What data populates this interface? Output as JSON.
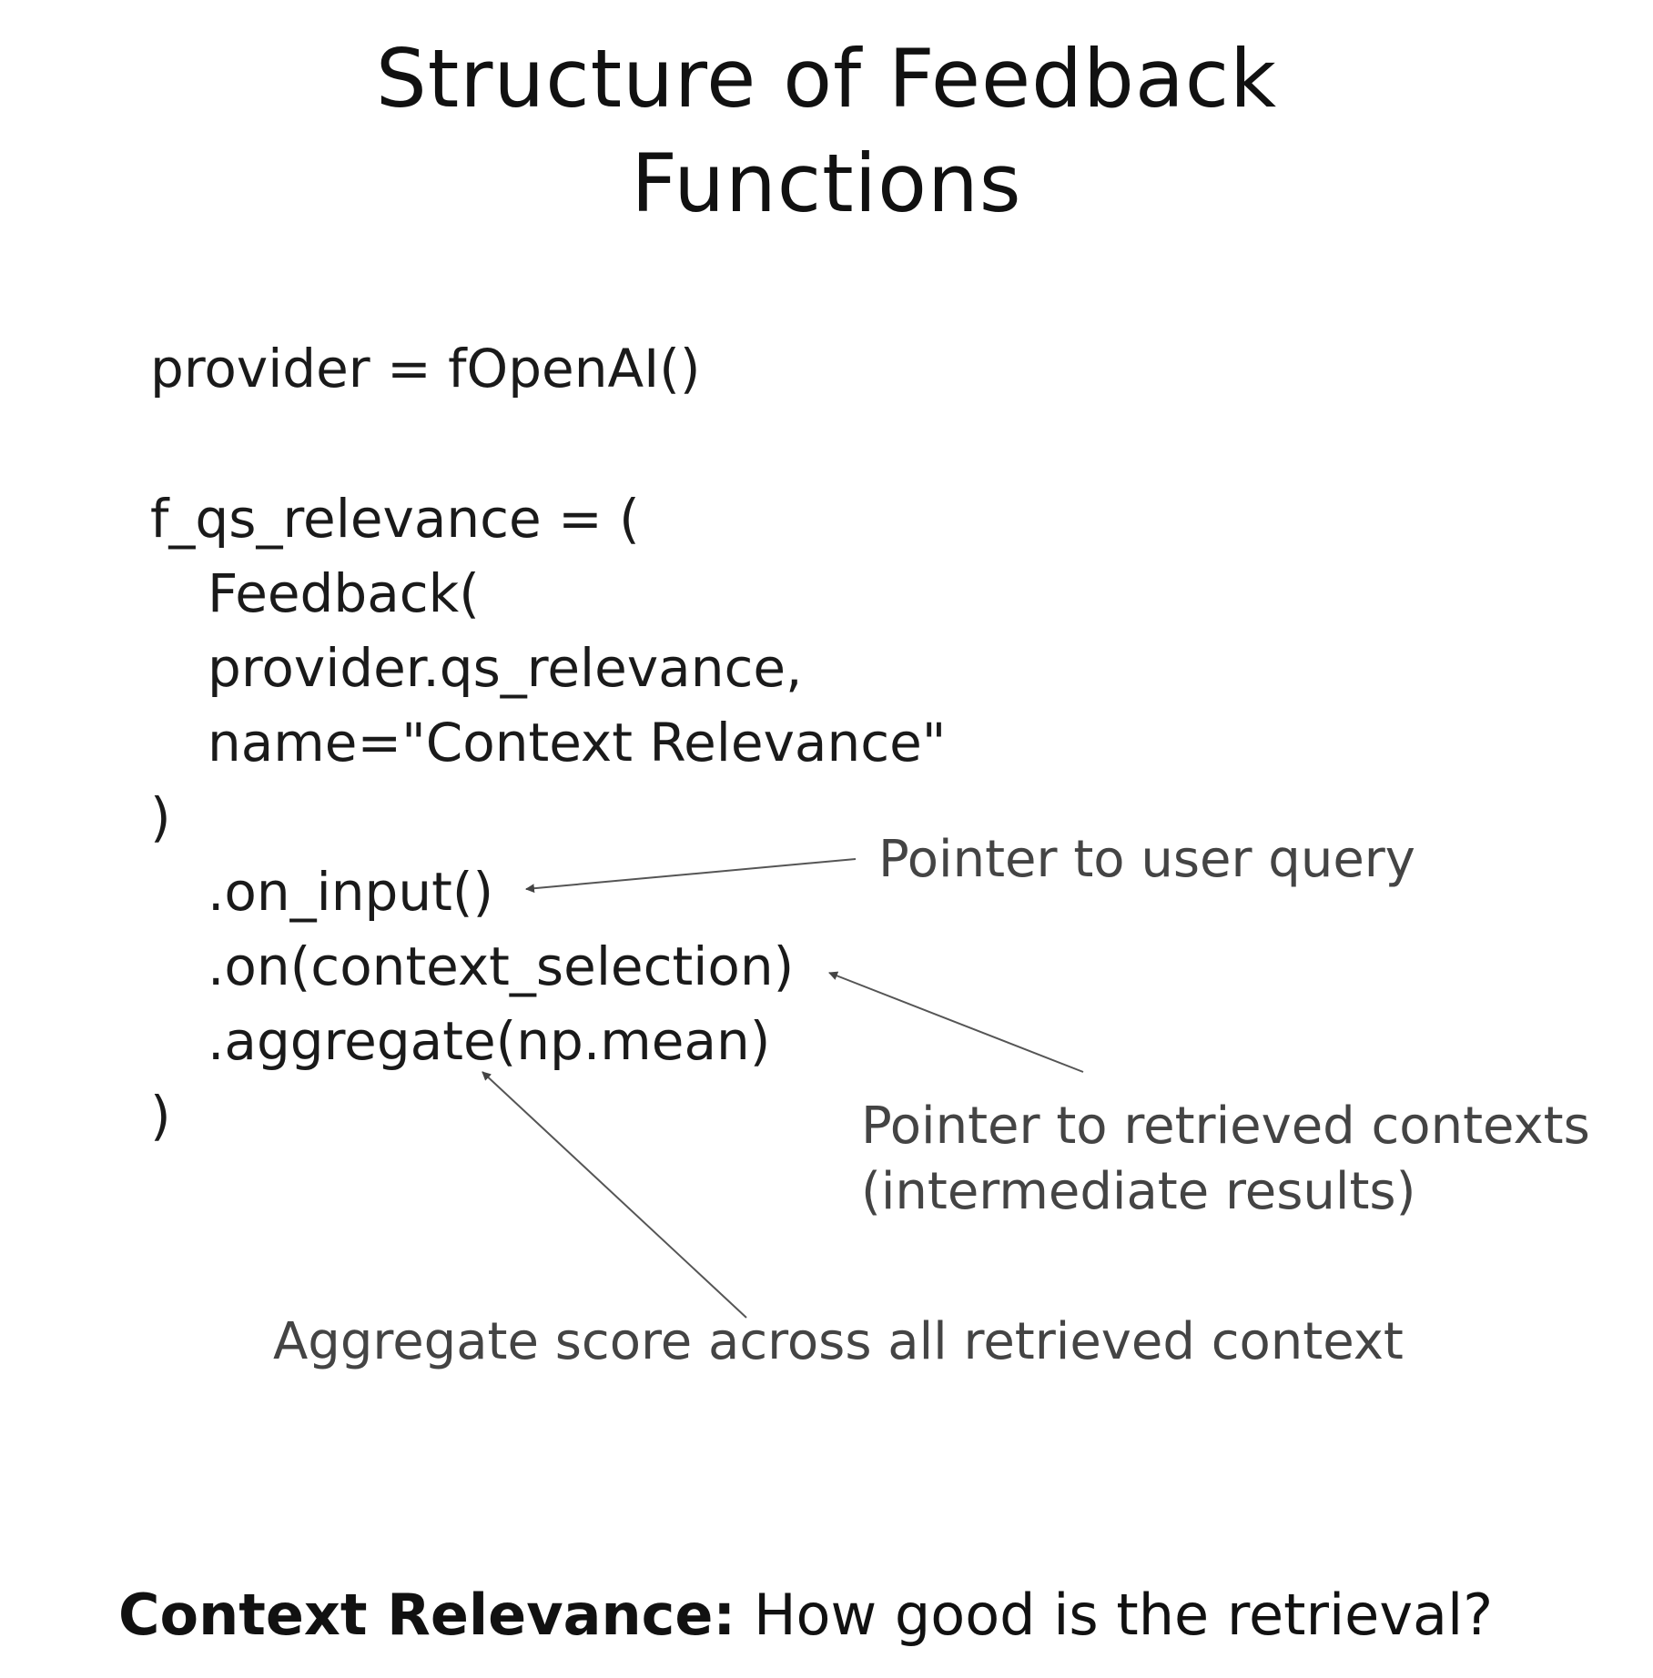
{
  "title": {
    "line1": "Structure of Feedback",
    "line2": "Functions"
  },
  "code": {
    "lines": [
      "provider = fOpenAI()",
      "f_qs_relevance = (",
      "Feedback(",
      "provider.qs_relevance,",
      "name=\"Context Relevance\"",
      ")",
      ".on_input()",
      ".on(context_selection)",
      ".aggregate(np.mean)",
      ")"
    ]
  },
  "annotations": {
    "user_query": "Pointer to user query",
    "retrieved_contexts_line1": "Pointer to retrieved contexts",
    "retrieved_contexts_line2": "(intermediate results)",
    "aggregate": "Aggregate score across all retrieved context"
  },
  "footer": {
    "term": "Context Relevance:",
    "question": "How good is the retrieval?"
  }
}
